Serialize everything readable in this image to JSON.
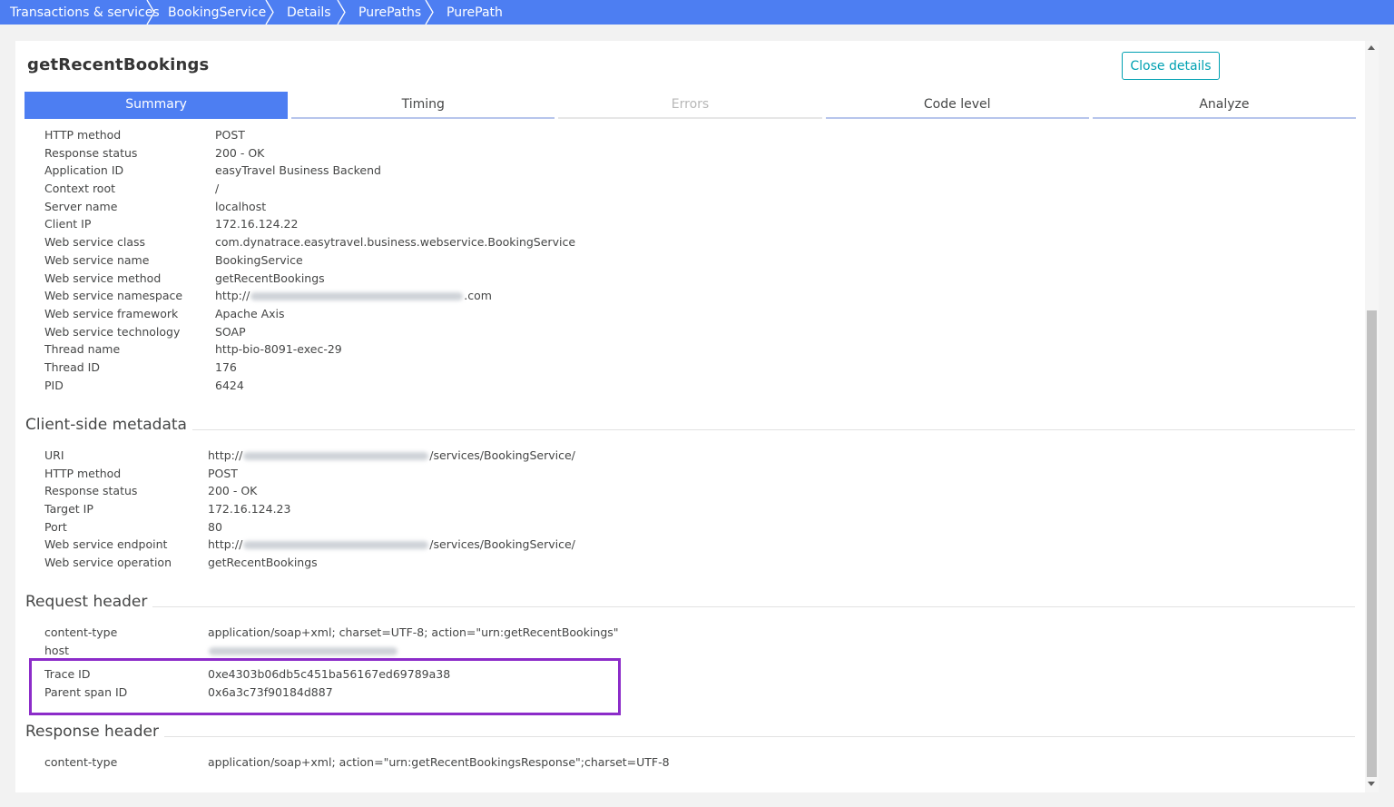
{
  "breadcrumbs": [
    "Transactions & services",
    "BookingService",
    "Details",
    "PurePaths",
    "PurePath"
  ],
  "panel": {
    "title": "getRecentBookings",
    "close_label": "Close details"
  },
  "tabs": [
    {
      "label": "Summary"
    },
    {
      "label": "Timing"
    },
    {
      "label": "Errors"
    },
    {
      "label": "Code level"
    },
    {
      "label": "Analyze"
    }
  ],
  "summary": {
    "http_method": {
      "label": "HTTP method",
      "value": "POST"
    },
    "response_status": {
      "label": "Response status",
      "value": "200 - OK"
    },
    "application_id": {
      "label": "Application ID",
      "value": "easyTravel Business Backend"
    },
    "context_root": {
      "label": "Context root",
      "value": "/"
    },
    "server_name": {
      "label": "Server name",
      "value": "localhost"
    },
    "client_ip": {
      "label": "Client IP",
      "value": "172.16.124.22"
    },
    "ws_class": {
      "label": "Web service class",
      "value": "com.dynatrace.easytravel.business.webservice.BookingService"
    },
    "ws_name": {
      "label": "Web service name",
      "value": "BookingService"
    },
    "ws_method": {
      "label": "Web service method",
      "value": "getRecentBookings"
    },
    "ws_namespace": {
      "label": "Web service namespace",
      "prefix": "http://",
      "suffix": ".com"
    },
    "ws_framework": {
      "label": "Web service framework",
      "value": "Apache Axis"
    },
    "ws_technology": {
      "label": "Web service technology",
      "value": "SOAP"
    },
    "thread_name": {
      "label": "Thread name",
      "value": "http-bio-8091-exec-29"
    },
    "thread_id": {
      "label": "Thread ID",
      "value": "176"
    },
    "pid": {
      "label": "PID",
      "value": "6424"
    }
  },
  "client_metadata": {
    "heading": "Client-side metadata",
    "uri": {
      "label": "URI",
      "prefix": "http://",
      "suffix": "/services/BookingService/"
    },
    "http_method": {
      "label": "HTTP method",
      "value": "POST"
    },
    "response_status": {
      "label": "Response status",
      "value": "200 - OK"
    },
    "target_ip": {
      "label": "Target IP",
      "value": "172.16.124.23"
    },
    "port": {
      "label": "Port",
      "value": "80"
    },
    "endpoint": {
      "label": "Web service endpoint",
      "prefix": "http://",
      "suffix": "/services/BookingService/"
    },
    "operation": {
      "label": "Web service operation",
      "value": "getRecentBookings"
    }
  },
  "request_header": {
    "heading": "Request header",
    "content_type": {
      "label": "content-type",
      "value": "application/soap+xml; charset=UTF-8; action=\"urn:getRecentBookings\""
    },
    "host": {
      "label": "host"
    },
    "trace_id": {
      "label": "Trace ID",
      "value": "0xe4303b06db5c451ba56167ed69789a38"
    },
    "parent_span_id": {
      "label": "Parent span ID",
      "value": "0x6a3c73f90184d887"
    }
  },
  "response_header": {
    "heading": "Response header",
    "content_type": {
      "label": "content-type",
      "value": "application/soap+xml; action=\"urn:getRecentBookingsResponse\";charset=UTF-8"
    }
  },
  "colors": {
    "accent": "#4d7ef2",
    "button": "#00a1b2",
    "highlight": "#8c2cc9"
  }
}
